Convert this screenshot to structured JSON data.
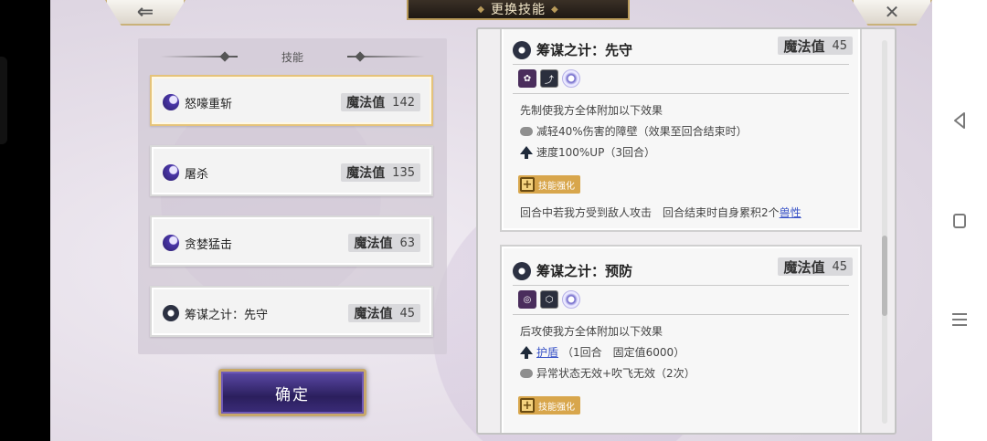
{
  "header": {
    "title": "更换技能",
    "back_icon": "arrow-left-icon",
    "close_icon": "close-icon"
  },
  "panel": {
    "title": "技能",
    "skills": [
      {
        "name": "怒嚎重斩",
        "mana_label": "魔法值",
        "mana": "142",
        "icon": "moon-icon",
        "selected": true
      },
      {
        "name": "屠杀",
        "mana_label": "魔法值",
        "mana": "135",
        "icon": "moon-icon",
        "selected": false
      },
      {
        "name": "贪婪猛击",
        "mana_label": "魔法值",
        "mana": "63",
        "icon": "moon-icon",
        "selected": false
      },
      {
        "name": "筹谋之计：先守",
        "mana_label": "魔法值",
        "mana": "45",
        "icon": "gear-icon",
        "selected": false
      }
    ]
  },
  "confirm_label": "确定",
  "details": {
    "card1": {
      "title": "筹谋之计：先守",
      "mana_label": "魔法值",
      "mana": "45",
      "line1": "先制使我方全体附加以下效果",
      "line2": "减轻40%伤害的障壁（效果至回合结束时）",
      "line3": "速度100%UP（3回合）",
      "enhance_label": "技能强化",
      "line4_prefix": "回合中若我方受到敌人攻击　回合结束时自身累积2个",
      "line4_link": "兽性"
    },
    "card2": {
      "title": "筹谋之计：预防",
      "mana_label": "魔法值",
      "mana": "45",
      "line1": "后攻使我方全体附加以下效果",
      "line2_link": "护盾",
      "line2_rest": "（1回合　固定值6000）",
      "line3": "异常状态无效+吹飞无效（2次）",
      "enhance_label": "技能强化"
    }
  },
  "system_nav": {
    "back_icon": "nav-back-icon",
    "home_icon": "nav-home-icon",
    "menu_icon": "nav-recents-icon"
  }
}
